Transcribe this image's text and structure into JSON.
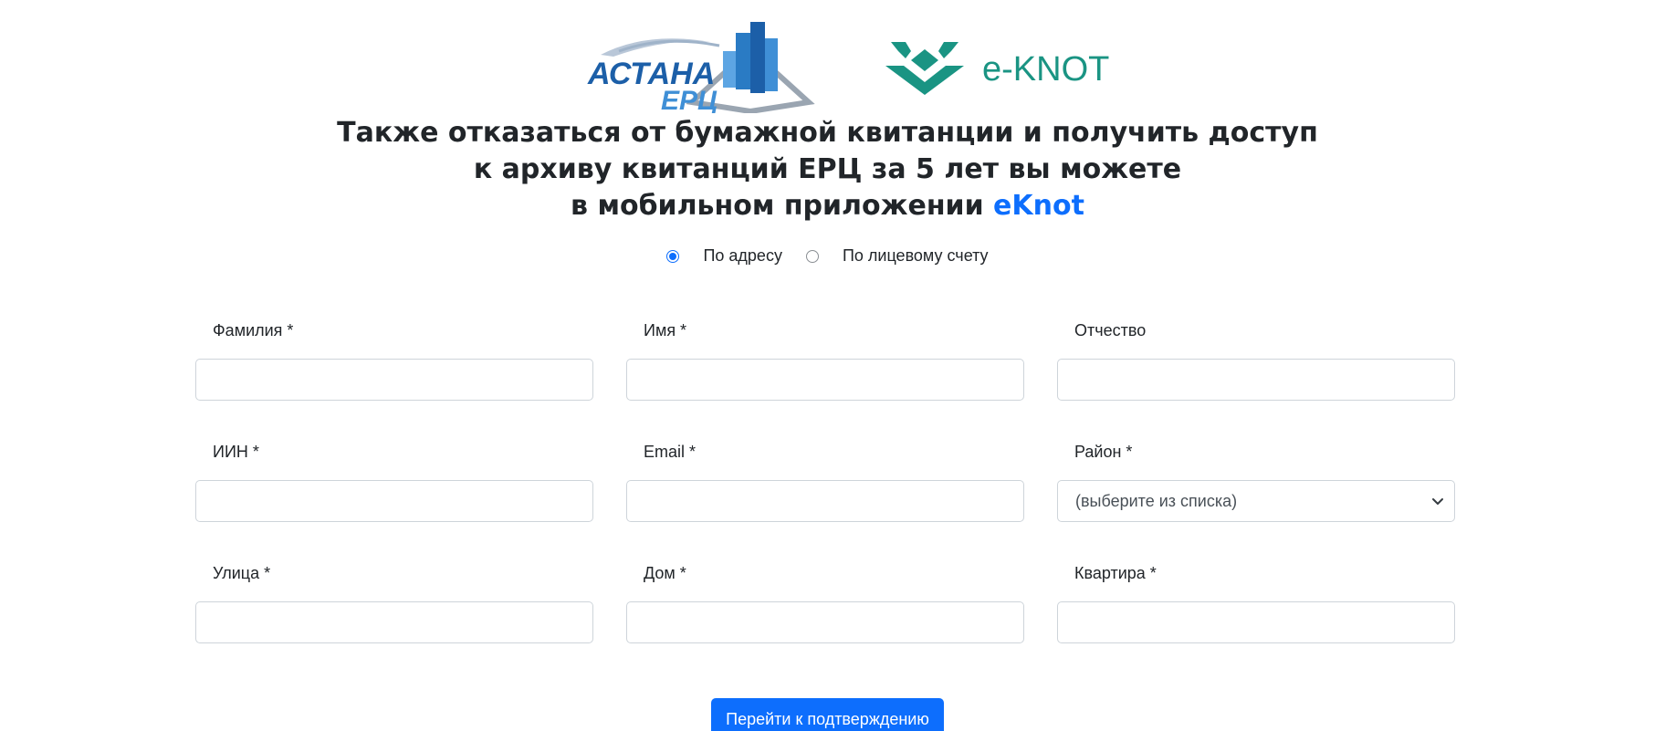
{
  "logos": {
    "astana": {
      "line1": "АСТАНА",
      "line2": "ЕРЦ"
    },
    "eknot": {
      "text": "e-KNOT"
    }
  },
  "headline": {
    "line1": "Также отказаться от бумажной квитанции и получить доступ",
    "line2": "к архиву квитанций ЕРЦ за 5 лет вы можете",
    "line3_prefix": "в мобильном приложении ",
    "line3_accent": "eKnot"
  },
  "search_mode": {
    "options": [
      {
        "label": "По адресу",
        "checked": true
      },
      {
        "label": "По лицевому счету",
        "checked": false
      }
    ]
  },
  "form": {
    "surname": {
      "label": "Фамилия *",
      "value": ""
    },
    "name": {
      "label": "Имя *",
      "value": ""
    },
    "patronymic": {
      "label": "Отчество",
      "value": ""
    },
    "iin": {
      "label": "ИИН *",
      "value": ""
    },
    "email": {
      "label": "Email *",
      "value": ""
    },
    "district": {
      "label": "Район *",
      "selected": "(выберите из списка)"
    },
    "street": {
      "label": "Улица *",
      "value": ""
    },
    "house": {
      "label": "Дом *",
      "value": ""
    },
    "apartment": {
      "label": "Квартира *",
      "value": ""
    }
  },
  "submit": {
    "label": "Перейти к подтверждению"
  },
  "colors": {
    "accent": "#0d6efd",
    "astana_blue": "#1c5fa8",
    "astana_light": "#3f8fd6",
    "eknot_teal": "#1a9483"
  }
}
